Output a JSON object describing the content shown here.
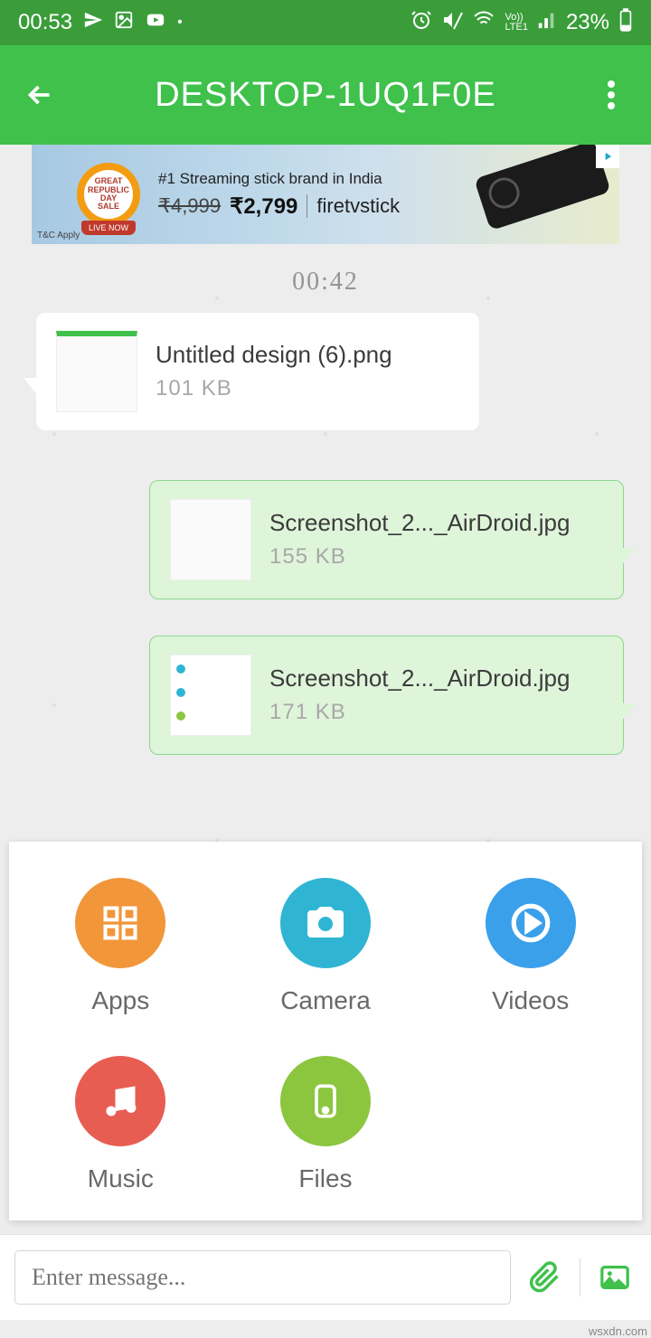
{
  "status": {
    "time": "00:53",
    "battery": "23%"
  },
  "header": {
    "title": "DESKTOP-1UQ1F0E"
  },
  "ad": {
    "badge_line1": "GREAT",
    "badge_line2": "REPUBLIC",
    "badge_line3": "DAY",
    "badge_line4": "SALE",
    "headline": "#1 Streaming stick brand in India",
    "old_price": "₹4,999",
    "new_price": "₹2,799",
    "brand": "firetvstick",
    "tc": "T&C Apply"
  },
  "chat": {
    "timestamp": "00:42",
    "messages": [
      {
        "direction": "in",
        "filename": "Untitled design (6).png",
        "size": "101 KB"
      },
      {
        "direction": "out",
        "filename": "Screenshot_2..._AirDroid.jpg",
        "size": "155 KB"
      },
      {
        "direction": "out",
        "filename": "Screenshot_2..._AirDroid.jpg",
        "size": "171 KB"
      }
    ]
  },
  "attach": {
    "items": [
      {
        "label": "Apps",
        "color": "c-orange",
        "icon": "apps"
      },
      {
        "label": "Camera",
        "color": "c-teal",
        "icon": "camera"
      },
      {
        "label": "Videos",
        "color": "c-blue",
        "icon": "video"
      },
      {
        "label": "Music",
        "color": "c-red",
        "icon": "music"
      },
      {
        "label": "Files",
        "color": "c-green",
        "icon": "files"
      }
    ]
  },
  "input": {
    "placeholder": "Enter message..."
  },
  "watermark": "wsxdn.com"
}
